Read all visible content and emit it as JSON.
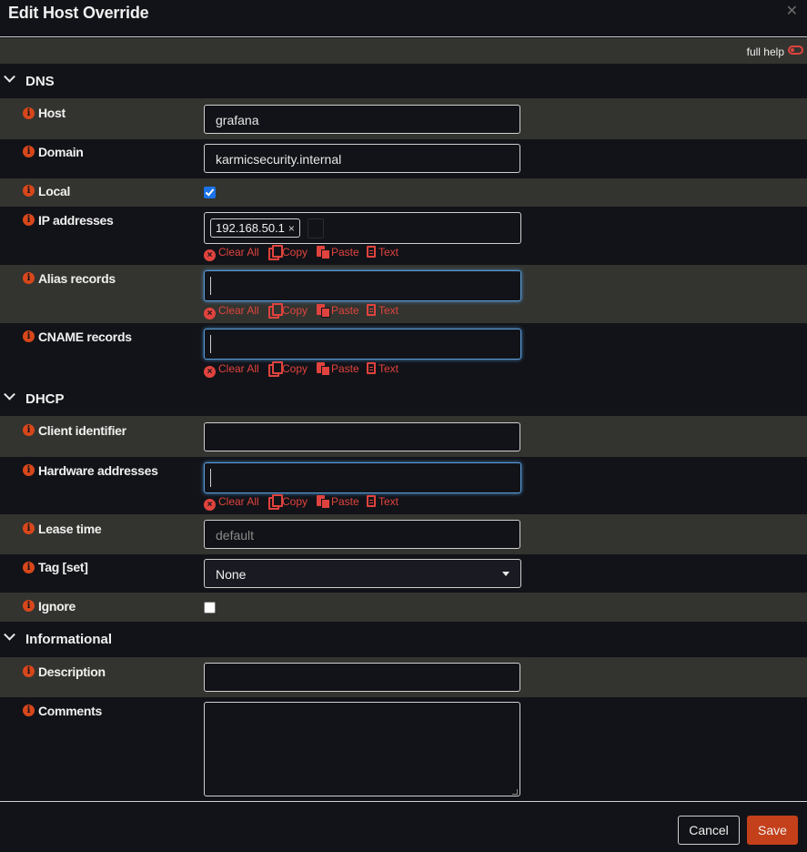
{
  "dialog": {
    "title": "Edit Host Override"
  },
  "help": {
    "label": "full help"
  },
  "sections": {
    "dns": "DNS",
    "dhcp": "DHCP",
    "informational": "Informational"
  },
  "fields": {
    "host": {
      "label": "Host",
      "value": "grafana"
    },
    "domain": {
      "label": "Domain",
      "value": "karmicsecurity.internal"
    },
    "local": {
      "label": "Local",
      "checked": true
    },
    "ip_addresses": {
      "label": "IP addresses",
      "tags": [
        "192.168.50.1"
      ]
    },
    "alias_records": {
      "label": "Alias records"
    },
    "cname_records": {
      "label": "CNAME records"
    },
    "client_identifier": {
      "label": "Client identifier",
      "value": ""
    },
    "hardware_addresses": {
      "label": "Hardware addresses"
    },
    "lease_time": {
      "label": "Lease time",
      "placeholder": "default"
    },
    "tag_set": {
      "label": "Tag [set]",
      "selected": "None"
    },
    "ignore": {
      "label": "Ignore",
      "checked": false
    },
    "description": {
      "label": "Description",
      "value": ""
    },
    "comments": {
      "label": "Comments",
      "value": ""
    }
  },
  "token_actions": {
    "clear_all": "Clear All",
    "copy": "Copy",
    "paste": "Paste",
    "text": "Text"
  },
  "buttons": {
    "cancel": "Cancel",
    "save": "Save"
  },
  "icons": {
    "close": "close-icon",
    "info": "info-icon",
    "chevron": "chevron-down-icon",
    "toggle": "toggle-icon"
  },
  "colors": {
    "background": "#121318",
    "row_alt": "#33342f",
    "accent": "#d7471b",
    "action": "#e0433e",
    "save_button": "#c4401a",
    "checkbox": "#1a73e8"
  }
}
